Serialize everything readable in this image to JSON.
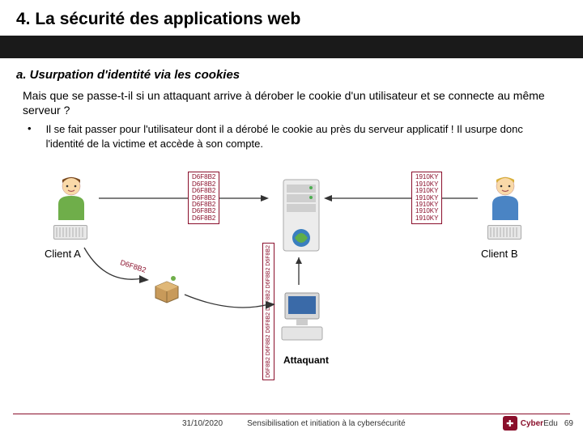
{
  "header": {
    "title": "4. La sécurité des applications web"
  },
  "subtitle": "a. Usurpation d'identité via les cookies",
  "question": "Mais que se passe-t-il si un attaquant arrive à dérober le cookie d'un utilisateur et se connecte au même serveur ?",
  "bullet": "Il se fait passer pour l'utilisateur dont il a dérobé le cookie au près du serveur applicatif ! Il usurpe donc l'identité de la victime et accède à son compte.",
  "diagram": {
    "clientA": "Client A",
    "clientB": "Client B",
    "attacker": "Attaquant",
    "cookieA_code": "D6F8B2",
    "cookieB_code": "1910KY",
    "cookieA_lines": [
      "D6F8B2",
      "D6F8B2",
      "D6F8B2",
      "D6F8B2",
      "D6F8B2",
      "D6F8B2",
      "D6F8B2"
    ],
    "cookieB_lines": [
      "1910KY",
      "1910KY",
      "1910KY",
      "1910KY",
      "1910KY",
      "1910KY",
      "1910KY"
    ],
    "stolen_label": "D6F8B2"
  },
  "footer": {
    "date": "31/10/2020",
    "doc_title": "Sensibilisation et initiation à la cybersécurité",
    "logo_brand": "Cyber",
    "logo_sub": "Edu",
    "page": "69"
  }
}
